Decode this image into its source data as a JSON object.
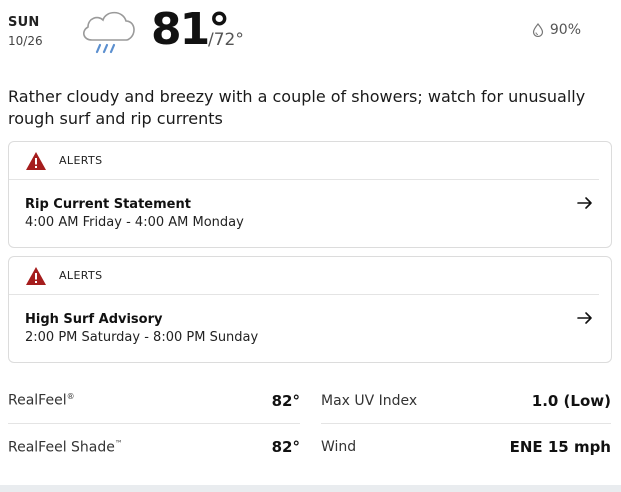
{
  "header": {
    "day": "SUN",
    "date": "10/26",
    "icon": "rain-cloud-icon",
    "high_temp": "81°",
    "low_temp": "/72°",
    "precip_icon": "droplet-icon",
    "precip": "90%"
  },
  "phrase": "Rather cloudy and breezy with a couple of showers; watch for unusually rough surf and rip currents",
  "alerts": [
    {
      "tag": "ALERTS",
      "title": "Rip Current Statement",
      "time": "4:00 AM Friday - 4:00 AM Monday",
      "icon": "warning-icon",
      "action_icon": "arrow-right-icon"
    },
    {
      "tag": "ALERTS",
      "title": "High Surf Advisory",
      "time": "2:00 PM Saturday - 8:00 PM Sunday",
      "icon": "warning-icon",
      "action_icon": "arrow-right-icon"
    }
  ],
  "details": [
    {
      "label": "RealFeel",
      "mark": "®",
      "value": "82°"
    },
    {
      "label": "Max UV Index",
      "mark": "",
      "value": "1.0 (Low)"
    },
    {
      "label": "RealFeel Shade",
      "mark": "™",
      "value": "82°"
    },
    {
      "label": "Wind",
      "mark": "",
      "value": "ENE 15 mph"
    }
  ],
  "colors": {
    "alert_red": "#a51d1d",
    "divider": "#e4e4e4",
    "card_border": "#dcdcdc"
  }
}
